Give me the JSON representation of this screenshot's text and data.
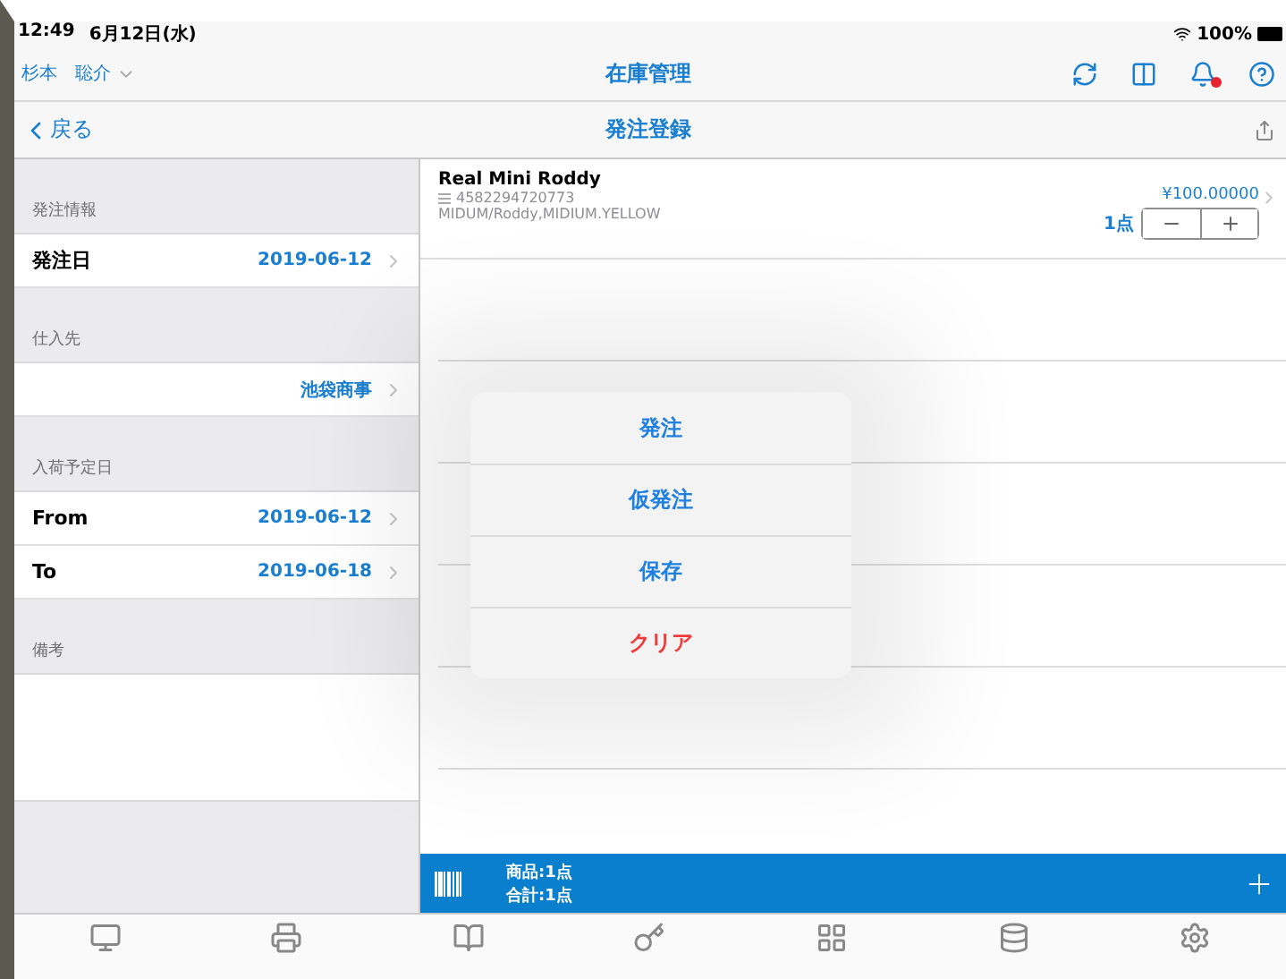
{
  "status_bar": {
    "time": "12:49",
    "date": "6月12日(水)",
    "battery": "100%"
  },
  "top_bar": {
    "user": "杉本　聡介",
    "title": "在庫管理",
    "notification": true
  },
  "nav_bar": {
    "back": "戻る",
    "title": "発注登録"
  },
  "form": {
    "sections": [
      {
        "kind": "rows",
        "header": "発注情報",
        "rows": [
          {
            "label": "発注日",
            "value": "2019-06-12"
          }
        ]
      },
      {
        "kind": "rows",
        "header": "仕入先",
        "rows": [
          {
            "label": "",
            "value": "池袋商事"
          }
        ]
      },
      {
        "kind": "rows",
        "header": "入荷予定日",
        "rows": [
          {
            "label": "From",
            "value": "2019-06-12"
          },
          {
            "label": "To",
            "value": "2019-06-18"
          }
        ]
      },
      {
        "kind": "notes",
        "header": "備考"
      }
    ]
  },
  "items": [
    {
      "name": "Real Mini Roddy",
      "code": "4582294720773",
      "variant": "MIDUM/Roddy,MIDIUM.YELLOW",
      "price": "¥100.00000",
      "quantity": "1点"
    }
  ],
  "action_menu": [
    {
      "label": "発注",
      "kind": "default"
    },
    {
      "label": "仮発注",
      "kind": "default"
    },
    {
      "label": "保存",
      "kind": "default"
    },
    {
      "label": "クリア",
      "kind": "destructive"
    }
  ],
  "summary": {
    "products": "商品:1点",
    "total": "合計:1点"
  }
}
